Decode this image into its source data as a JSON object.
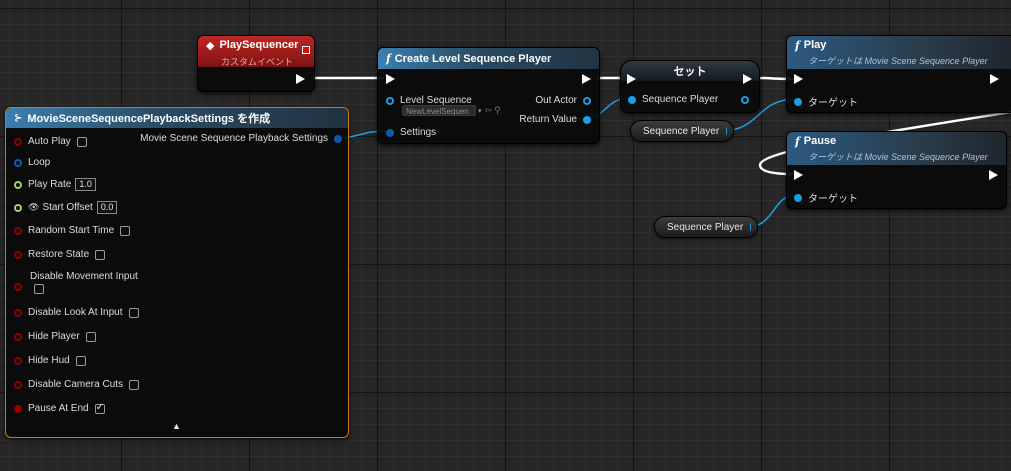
{
  "colors": {
    "wire_exec": "#ffffff",
    "wire_object": "#1ea0e6",
    "pin_bool": "#8f0000",
    "pin_float": "#9ed264",
    "pin_struct": "#0d5aa8",
    "pin_object": "#1a9ee6"
  },
  "event_node": {
    "title": "PlaySequencer",
    "subtitle": "カスタムイベント",
    "icon": "event-diamond-icon"
  },
  "create_node": {
    "title": "Create Level Sequence Player",
    "level_sequence_label": "Level Sequence",
    "level_sequence_value": "NewLevelSequen",
    "settings_label": "Settings",
    "out_actor_label": "Out Actor",
    "return_value_label": "Return Value"
  },
  "set_node": {
    "title": "セット",
    "sequence_player_label": "Sequence Player"
  },
  "play_node": {
    "title": "Play",
    "subtitle": "ターゲットは Movie Scene Sequence Player",
    "target_label": "ターゲット"
  },
  "pause_node": {
    "title": "Pause",
    "subtitle": "ターゲットは Movie Scene Sequence Player",
    "target_label": "ターゲット"
  },
  "var_get_1": {
    "label": "Sequence Player"
  },
  "var_get_2": {
    "label": "Sequence Player"
  },
  "make_node": {
    "title": "MovieSceneSequencePlaybackSettings を作成",
    "output_label": "Movie Scene Sequence Playback Settings",
    "fields": {
      "auto_play": "Auto Play",
      "loop": "Loop",
      "play_rate": "Play Rate",
      "play_rate_value": "1.0",
      "start_offset": "Start Offset",
      "start_offset_value": "0.0",
      "random_start_time": "Random Start Time",
      "restore_state": "Restore State",
      "disable_movement_input": "Disable Movement Input",
      "disable_look_at_input": "Disable Look At Input",
      "hide_player": "Hide Player",
      "hide_hud": "Hide Hud",
      "disable_camera_cuts": "Disable Camera Cuts",
      "pause_at_end": "Pause At End"
    }
  }
}
